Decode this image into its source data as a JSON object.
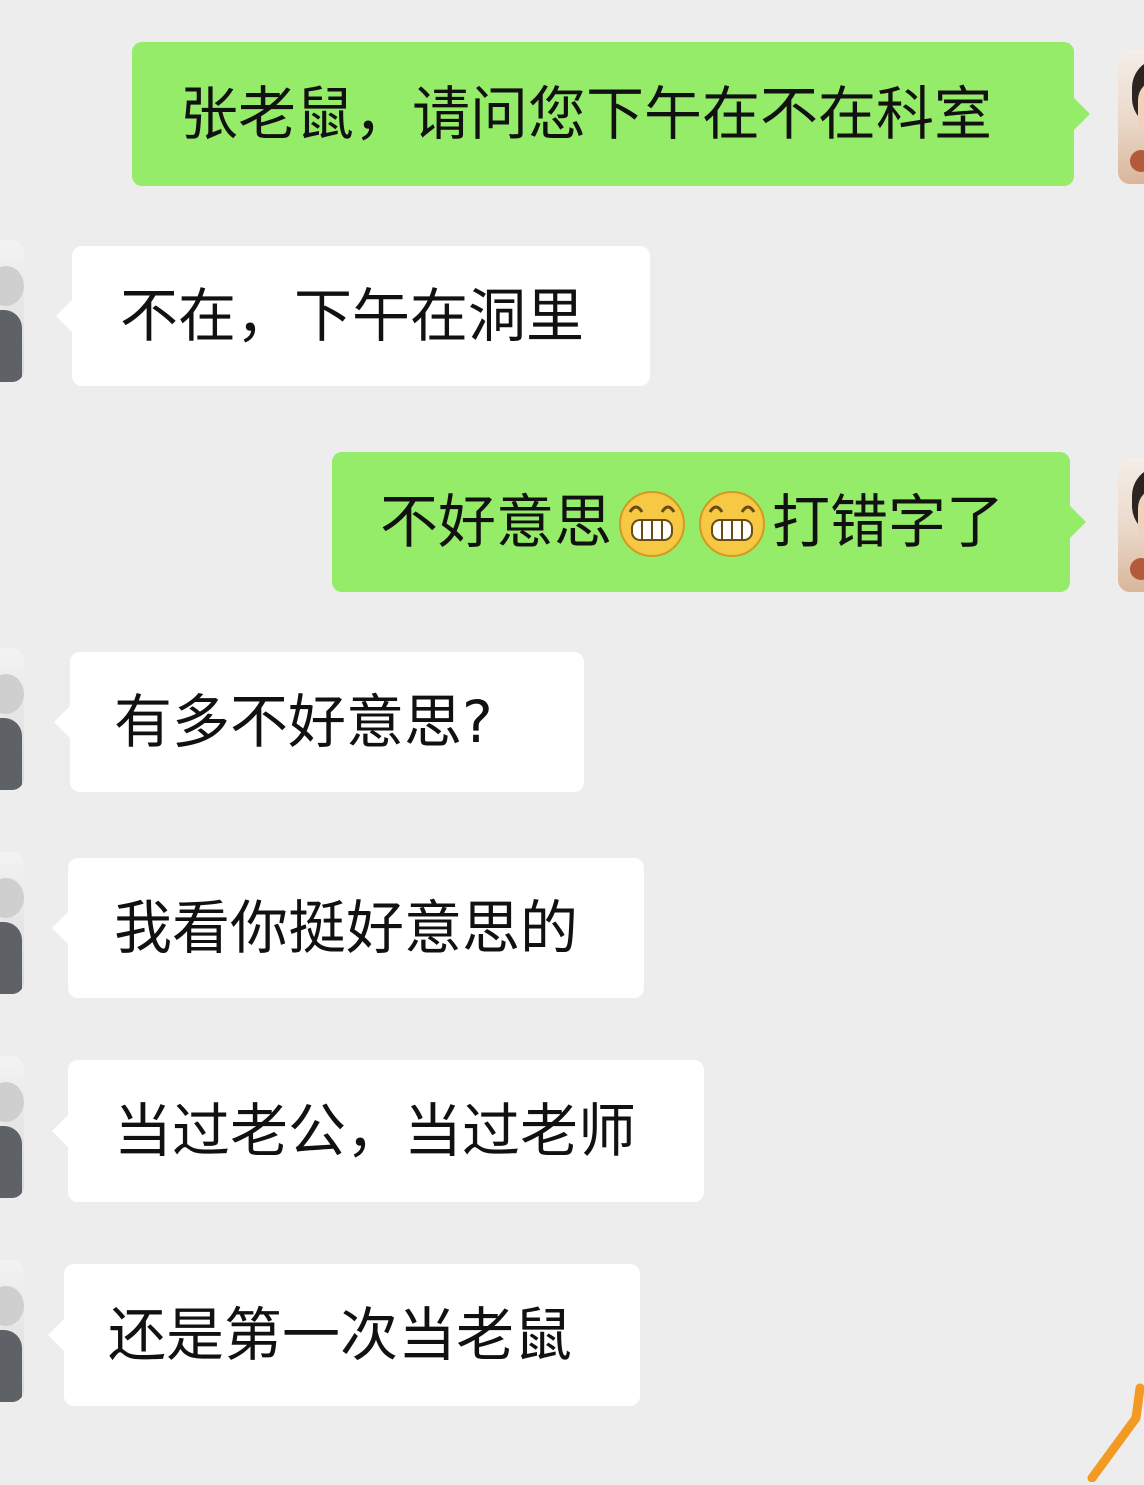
{
  "messages": [
    {
      "side": "sent",
      "text": "张老鼠，请问您下午在不在科室"
    },
    {
      "side": "received",
      "text": "不在，下午在洞里"
    },
    {
      "side": "sent",
      "text_before": "不好意思",
      "emoji": [
        "grin-emoji",
        "grin-emoji"
      ],
      "text_after": "打错字了"
    },
    {
      "side": "received",
      "text": "有多不好意思?"
    },
    {
      "side": "received",
      "text": "我看你挺好意思的"
    },
    {
      "side": "received",
      "text": "当过老公，当过老师"
    },
    {
      "side": "received",
      "text": "还是第一次当老鼠"
    }
  ],
  "colors": {
    "background": "#ededed",
    "sent_bubble": "#95ec69",
    "received_bubble": "#ffffff",
    "text": "#111111",
    "accent_stroke": "#f39a24"
  },
  "icons": {
    "emoji": "grin-emoji",
    "avatar_self": "user-avatar",
    "avatar_other": "contact-avatar"
  }
}
